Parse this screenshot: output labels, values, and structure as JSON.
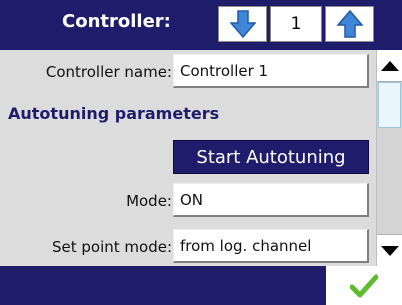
{
  "header": {
    "title": "Controller:",
    "index_value": "1",
    "prev_icon": "arrow-down-icon",
    "next_icon": "arrow-up-icon"
  },
  "form": {
    "controller_name": {
      "label": "Controller name:",
      "value": "Controller 1"
    },
    "section_title": "Autotuning parameters",
    "start_button_label": "Start Autotuning",
    "mode": {
      "label": "Mode:",
      "value": "ON"
    },
    "set_point_mode": {
      "label": "Set point mode:",
      "value": "from log. channel"
    }
  },
  "scrollbar": {
    "up_icon": "triangle-up-icon",
    "down_icon": "triangle-down-icon"
  },
  "footer": {
    "ok_icon": "checkmark-icon"
  },
  "colors": {
    "header_bg": "#1f1d6b",
    "button_bg": "#1f1d6b",
    "arrow_blue": "#3f86d6",
    "check_green": "#5dbb2c",
    "panel_bg": "#dcdcdc"
  }
}
